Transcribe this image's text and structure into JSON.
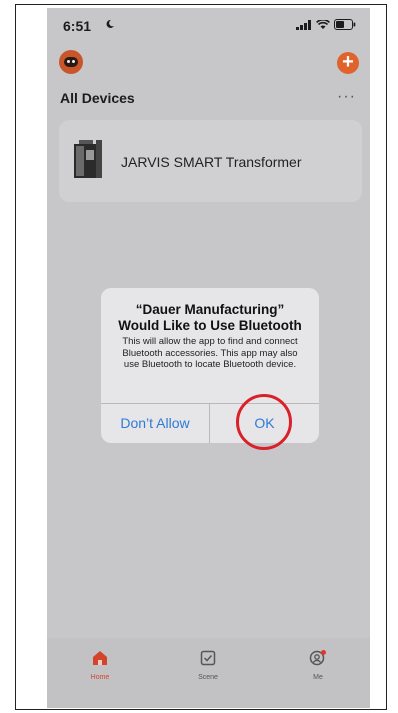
{
  "status_bar": {
    "time": "6:51"
  },
  "header": {
    "add_icon": "plus-icon"
  },
  "section": {
    "title": "All Devices",
    "more": "···"
  },
  "device": {
    "name": "JARVIS SMART Transformer"
  },
  "dialog": {
    "title": "“Dauer Manufacturing”\nWould Like to Use Bluetooth",
    "message": "This will allow the app to find and connect Bluetooth accessories. This app may also use Bluetooth to locate Bluetooth device.",
    "deny_label": "Don’t Allow",
    "ok_label": "OK"
  },
  "tabs": [
    {
      "label": "Home",
      "icon": "home-icon",
      "active": true
    },
    {
      "label": "Scene",
      "icon": "checkbox-icon",
      "active": false
    },
    {
      "label": "Me",
      "icon": "profile-icon",
      "active": false
    }
  ],
  "colors": {
    "accent": "#e0632c",
    "link": "#2f7ad6",
    "highlight": "#d9212b"
  }
}
